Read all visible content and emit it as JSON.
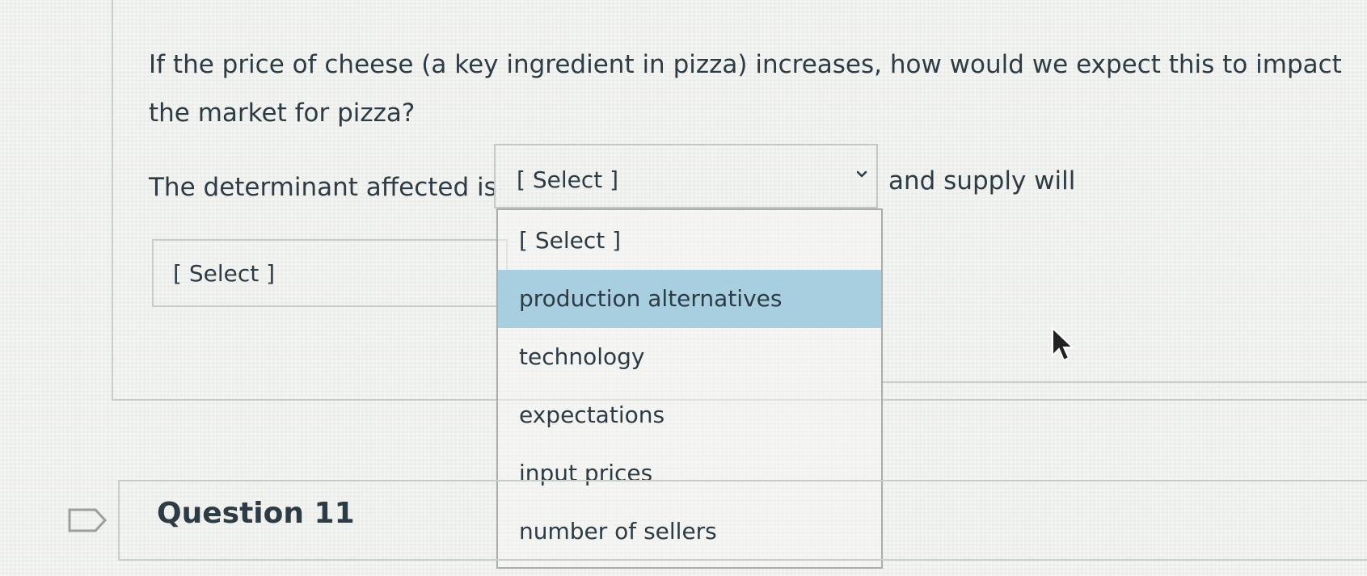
{
  "question": {
    "text": "If the price of cheese (a key ingredient in pizza) increases, how would we expect this to impact the market for pizza?",
    "sentence_start": "The determinant affected is",
    "sentence_end": "and supply will"
  },
  "select_determinant": {
    "value": "[ Select ]",
    "expanded": true
  },
  "select_supply": {
    "value": "[ Select ]"
  },
  "dropdown": {
    "options": [
      "[ Select ]",
      "production alternatives",
      "technology",
      "expectations",
      "input prices",
      "number of sellers"
    ],
    "highlighted": "production alternatives"
  },
  "next_question": {
    "title": "Question 11"
  },
  "icons": {
    "flag": "flag-outline-icon",
    "chevron": "chevron-down-icon",
    "cursor": "mouse-pointer-icon"
  },
  "colors": {
    "highlight": "#a8cfe0",
    "text": "#2d3b45",
    "border": "#c9cdca"
  }
}
